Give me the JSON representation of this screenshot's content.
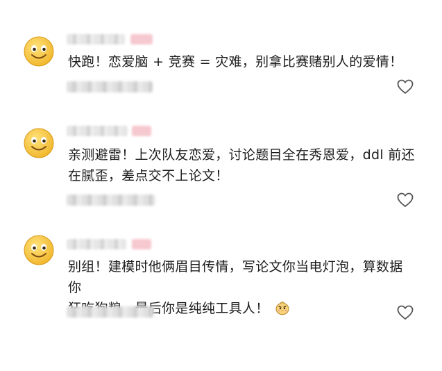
{
  "comments": [
    {
      "text_lines": [
        "快跑！恋爱脑 + 竞赛 = 灾难，别拿比赛赌别人的爱情！"
      ],
      "avatar_icon": "smiley-face-icon",
      "like_icon": "heart-outline-icon"
    },
    {
      "text_lines": [
        "亲测避雷！上次队友恋爱，讨论题目全在秀恩爱，ddl 前还",
        "在腻歪，差点交不上论文！"
      ],
      "avatar_icon": "smiley-face-icon",
      "like_icon": "heart-outline-icon"
    },
    {
      "text_lines": [
        "别组！建模时他俩眉目传情，写论文你当电灯泡，算数据你",
        "狂吃狗粮，最后你是纯纯工具人！"
      ],
      "avatar_icon": "smiley-face-icon",
      "like_icon": "heart-outline-icon",
      "trailing_emoji_icon": "sad-chick-emoji-icon"
    }
  ],
  "colors": {
    "text": "#1c1c1c",
    "avatar_yellow": "#f5c43a",
    "heart_stroke": "#555555",
    "badge_pink": "#f6c8cf"
  }
}
